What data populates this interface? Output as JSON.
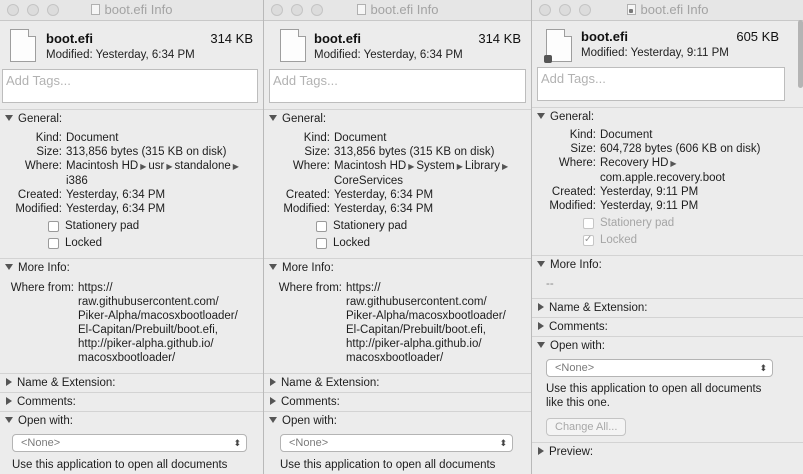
{
  "windows": [
    {
      "title": "boot.efi Info",
      "file_name": "boot.efi",
      "size": "314 KB",
      "modified_line": "Modified: Yesterday, 6:34 PM",
      "tags_placeholder": "Add Tags...",
      "general": {
        "header": "General:",
        "kind_label": "Kind:",
        "kind": "Document",
        "size_label": "Size:",
        "size_full": "313,856 bytes (315 KB on disk)",
        "where_label": "Where:",
        "where_path": [
          "Macintosh HD",
          "usr",
          "standalone"
        ],
        "where_last": "i386",
        "created_label": "Created:",
        "created": "Yesterday, 6:34 PM",
        "modified_label": "Modified:",
        "modified": "Yesterday, 6:34 PM",
        "stationery": "Stationery pad",
        "locked": "Locked"
      },
      "more_info": {
        "header": "More Info:",
        "where_from_label": "Where from:",
        "where_from": [
          "https://",
          "raw.githubusercontent.com/",
          "Piker-Alpha/macosxbootloader/",
          "El-Capitan/Prebuilt/boot.efi,",
          "http://piker-alpha.github.io/",
          "macosxbootloader/"
        ]
      },
      "name_ext": "Name & Extension:",
      "comments": "Comments:",
      "open_with": "Open with:",
      "select_value": "<None>",
      "use_app_text": "Use this application to open all documents"
    },
    {
      "title": "boot.efi Info",
      "file_name": "boot.efi",
      "size": "314 KB",
      "modified_line": "Modified: Yesterday, 6:34 PM",
      "tags_placeholder": "Add Tags...",
      "general": {
        "header": "General:",
        "kind_label": "Kind:",
        "kind": "Document",
        "size_label": "Size:",
        "size_full": "313,856 bytes (315 KB on disk)",
        "where_label": "Where:",
        "where_path": [
          "Macintosh HD",
          "System",
          "Library"
        ],
        "where_last": "CoreServices",
        "created_label": "Created:",
        "created": "Yesterday, 6:34 PM",
        "modified_label": "Modified:",
        "modified": "Yesterday, 6:34 PM",
        "stationery": "Stationery pad",
        "locked": "Locked"
      },
      "more_info": {
        "header": "More Info:",
        "where_from_label": "Where from:",
        "where_from": [
          "https://",
          "raw.githubusercontent.com/",
          "Piker-Alpha/macosxbootloader/",
          "El-Capitan/Prebuilt/boot.efi,",
          "http://piker-alpha.github.io/",
          "macosxbootloader/"
        ]
      },
      "name_ext": "Name & Extension:",
      "comments": "Comments:",
      "open_with": "Open with:",
      "select_value": "<None>",
      "use_app_text": "Use this application to open all documents"
    },
    {
      "title": "boot.efi Info",
      "file_name": "boot.efi",
      "size": "605 KB",
      "modified_line": "Modified: Yesterday, 9:11 PM",
      "tags_placeholder": "Add Tags...",
      "general": {
        "header": "General:",
        "kind_label": "Kind:",
        "kind": "Document",
        "size_label": "Size:",
        "size_full": "604,728 bytes (606 KB on disk)",
        "where_label": "Where:",
        "where_path": [
          "Recovery HD"
        ],
        "where_last": "com.apple.recovery.boot",
        "created_label": "Created:",
        "created": "Yesterday, 9:11 PM",
        "modified_label": "Modified:",
        "modified": "Yesterday, 9:11 PM",
        "stationery": "Stationery pad",
        "locked": "Locked"
      },
      "more_info": {
        "header": "More Info:",
        "empty": "--"
      },
      "name_ext": "Name & Extension:",
      "comments": "Comments:",
      "open_with": "Open with:",
      "select_value": "<None>",
      "use_app_line1": "Use this application to open all documents",
      "use_app_line2": "like this one.",
      "change_all": "Change All...",
      "preview": "Preview:"
    }
  ]
}
